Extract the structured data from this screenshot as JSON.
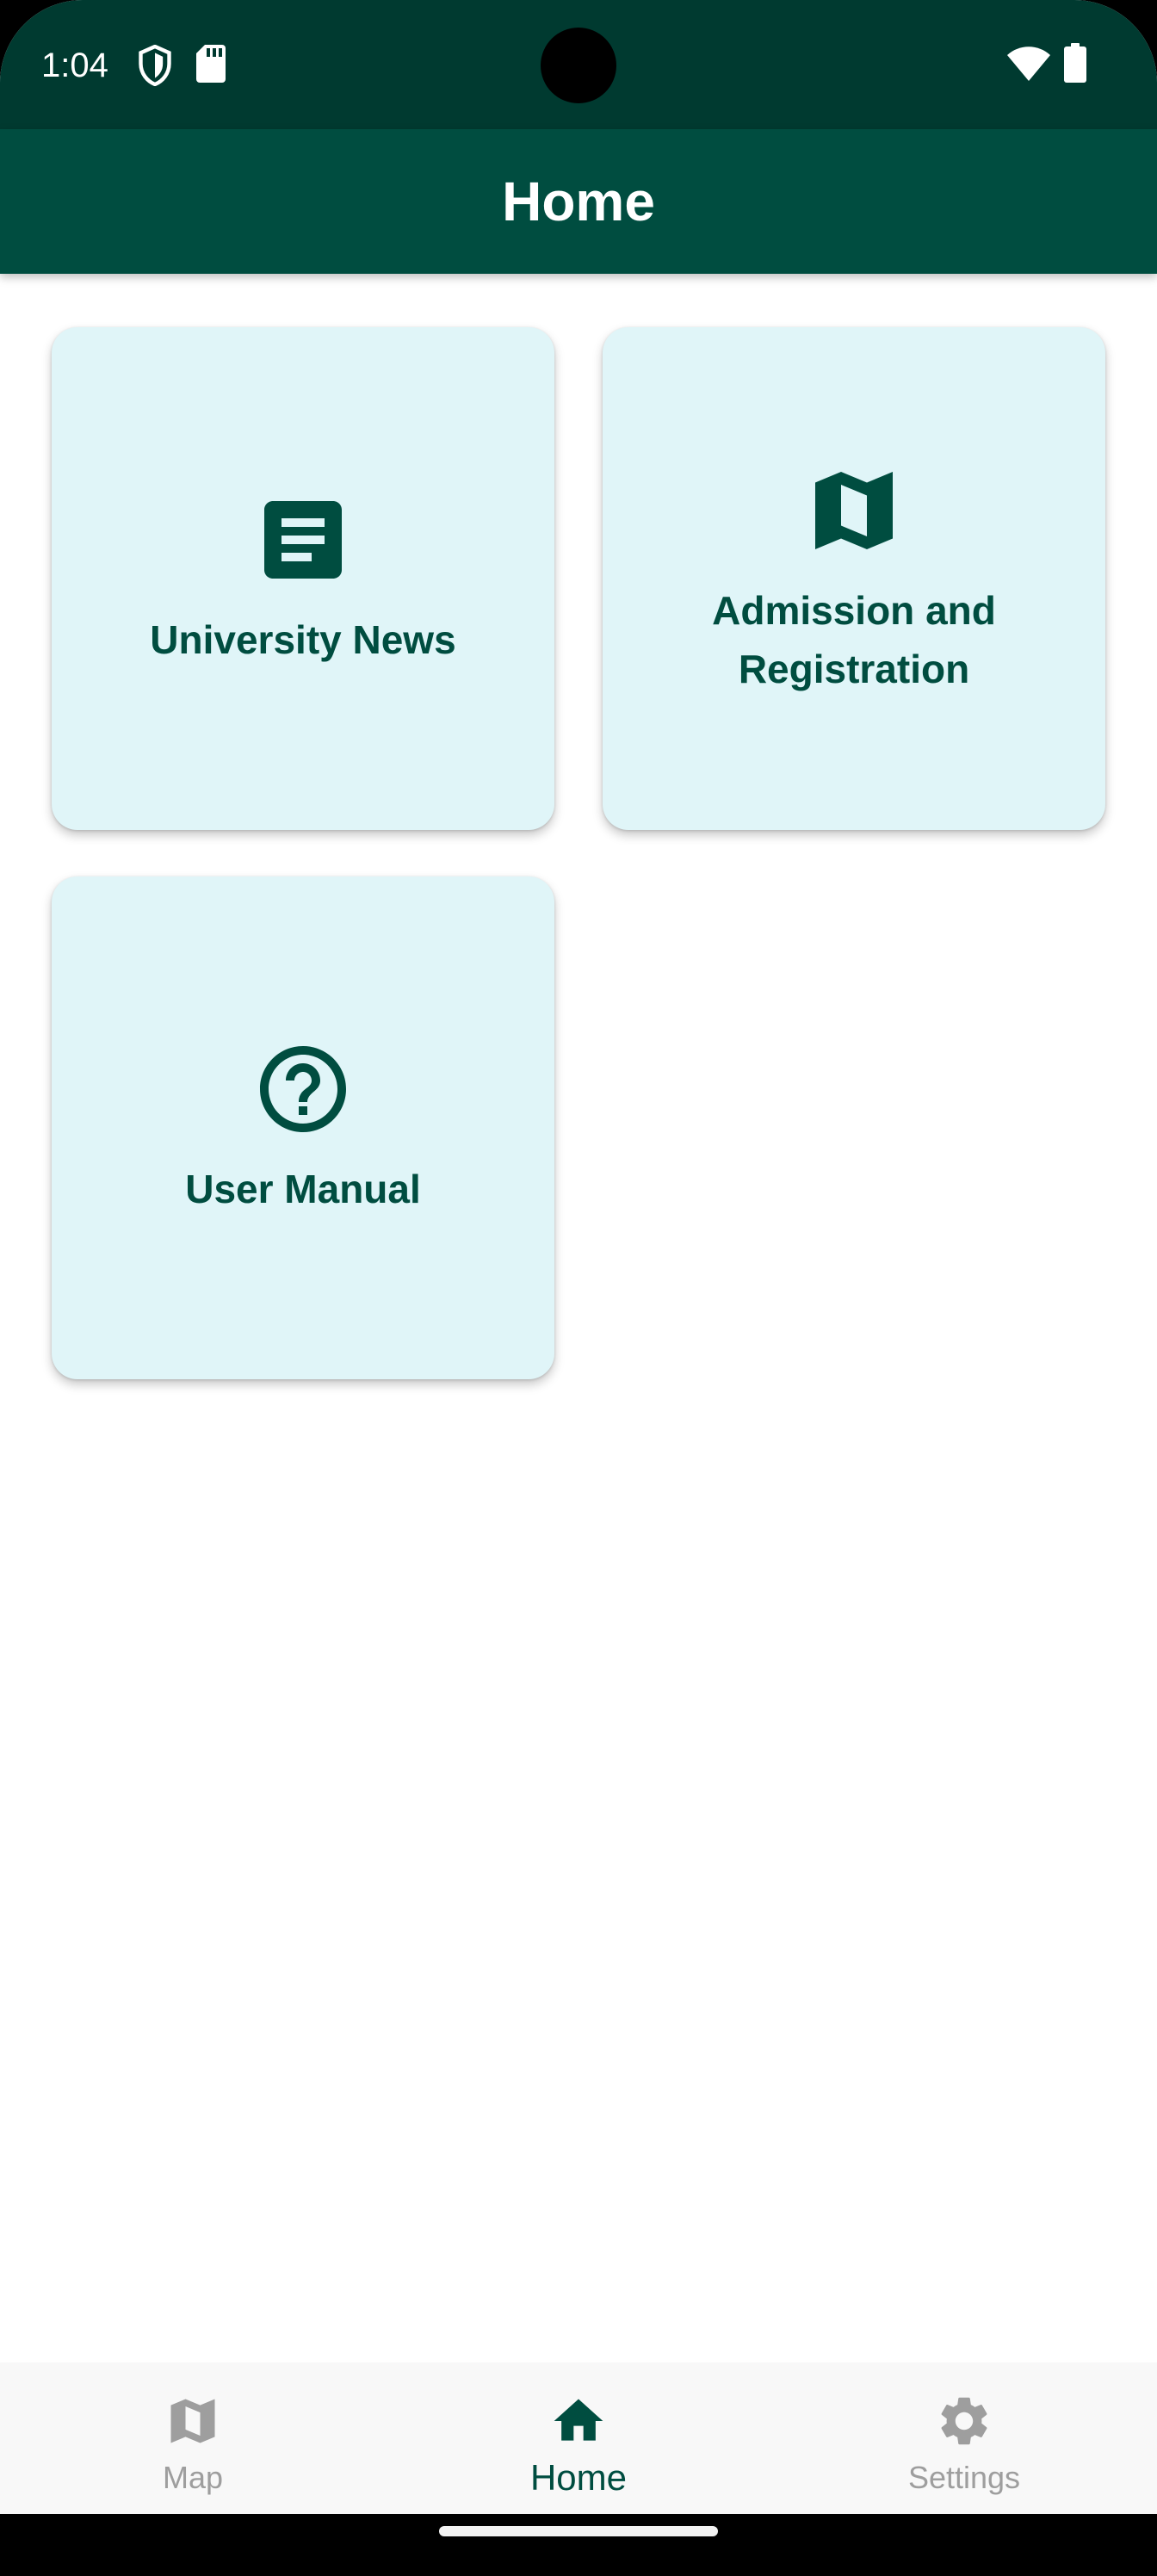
{
  "status_bar": {
    "time": "1:04",
    "icons": [
      "shield-icon",
      "sd-card-icon",
      "wifi-icon",
      "battery-icon"
    ]
  },
  "app_bar": {
    "title": "Home"
  },
  "cards": [
    {
      "label": "University News",
      "icon": "article-icon"
    },
    {
      "label": "Admission and Registration",
      "icon": "map-icon"
    },
    {
      "label": "User Manual",
      "icon": "help-circle-icon"
    }
  ],
  "bottom_nav": {
    "items": [
      {
        "label": "Map",
        "icon": "map-icon",
        "active": false
      },
      {
        "label": "Home",
        "icon": "home-icon",
        "active": true
      },
      {
        "label": "Settings",
        "icon": "gear-icon",
        "active": false
      }
    ]
  },
  "colors": {
    "status_bar_bg": "#003a30",
    "app_bar_bg": "#004d40",
    "card_bg": "#e0f5f8",
    "accent": "#004d40",
    "nav_inactive": "#9e9e9e"
  }
}
